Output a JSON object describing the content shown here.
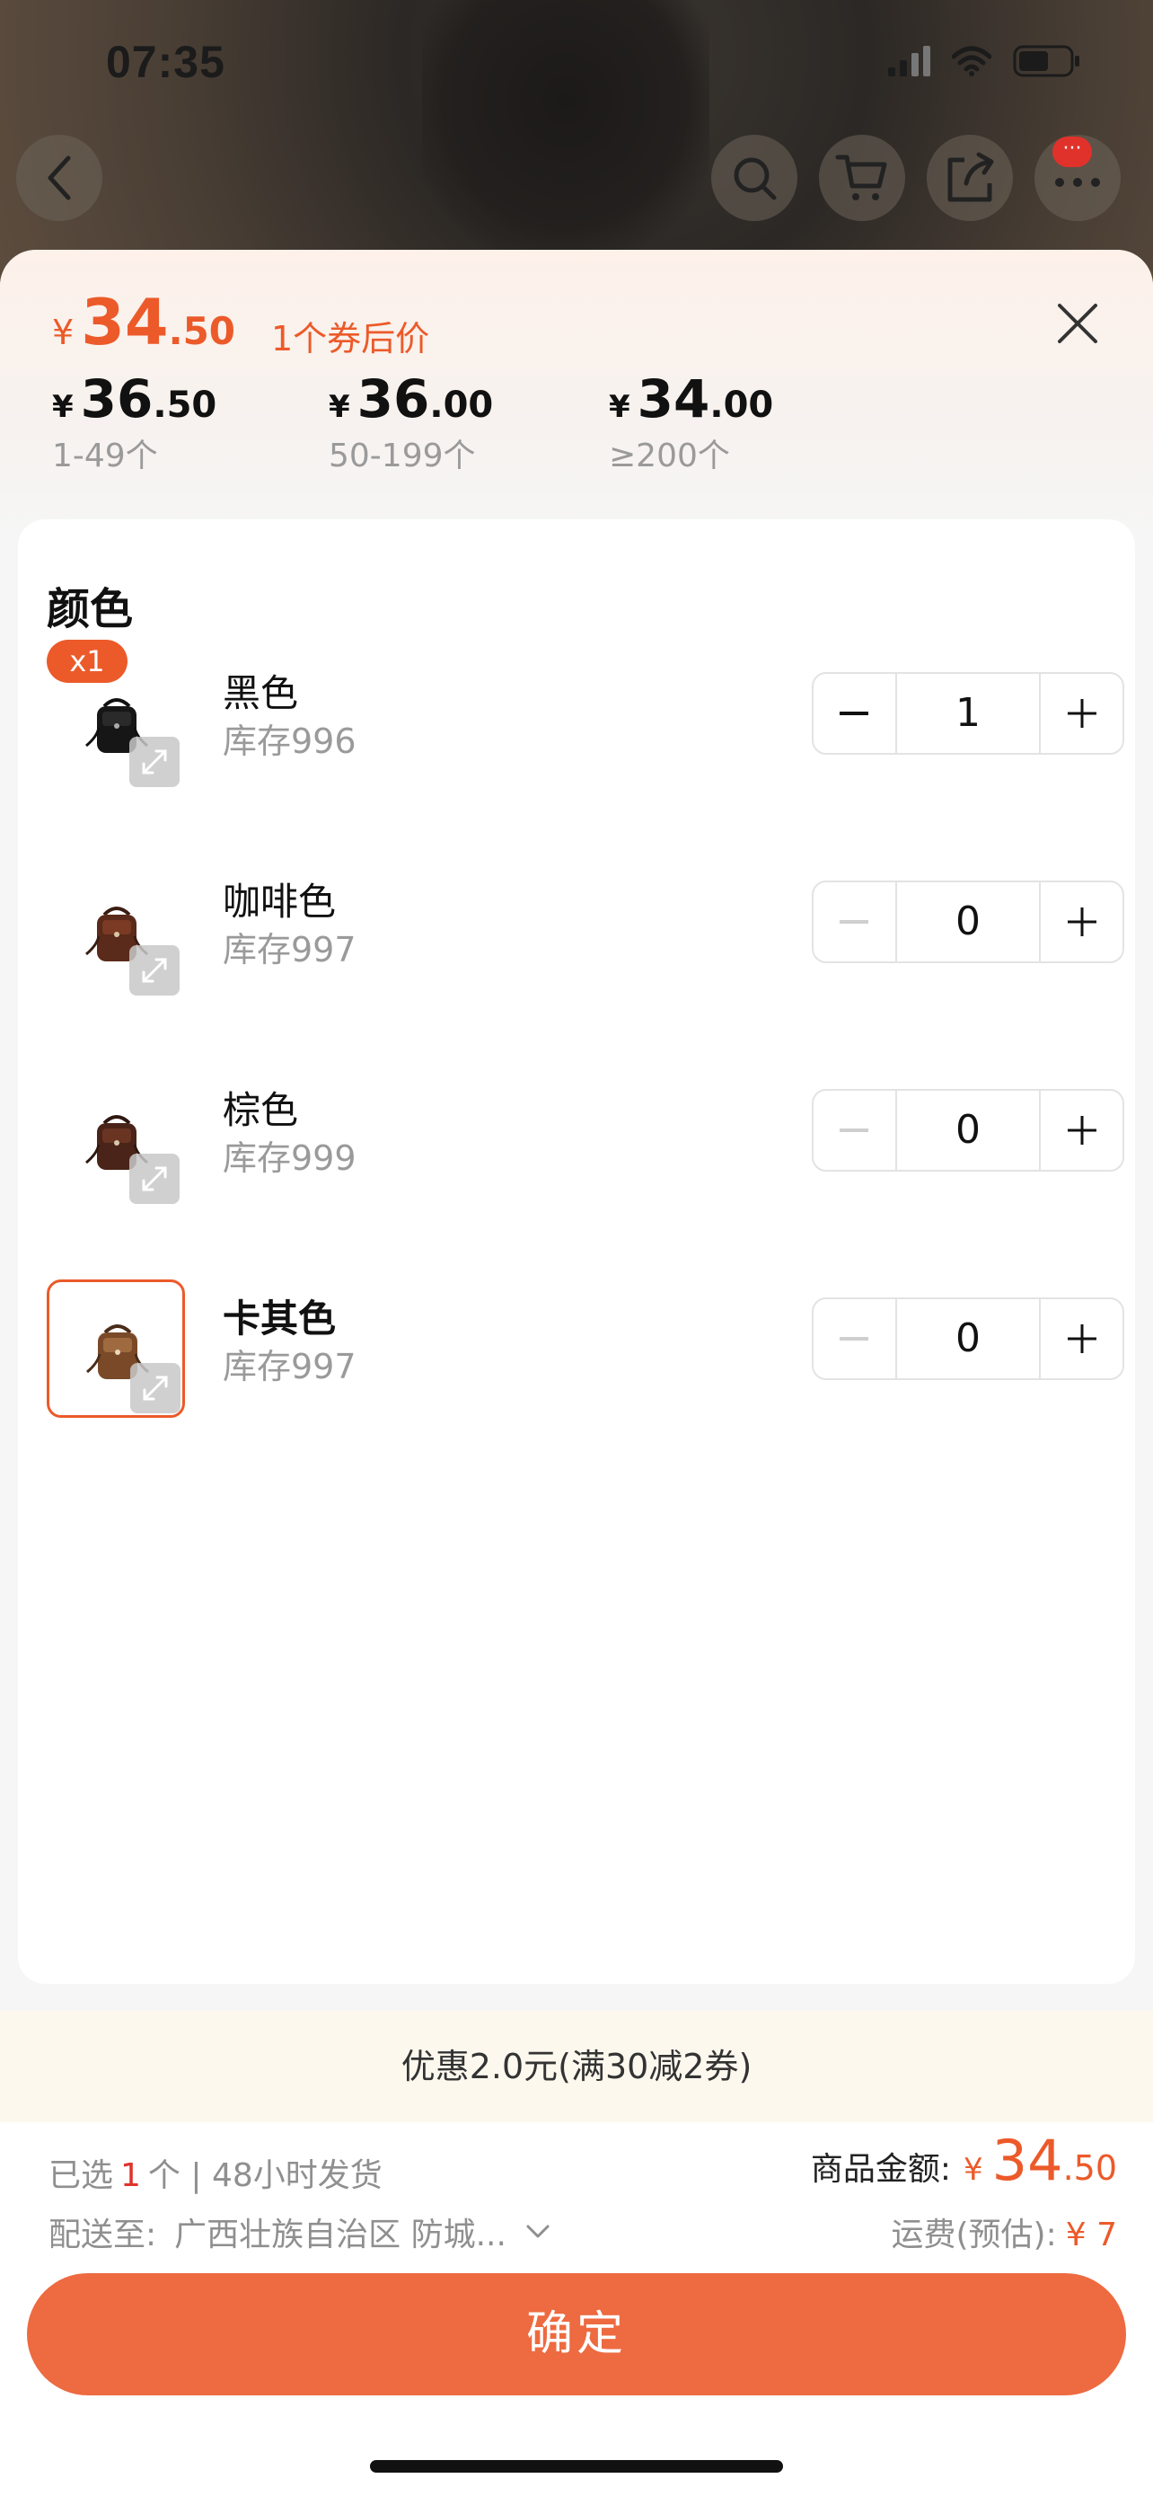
{
  "status_bar": {
    "time": "07:35"
  },
  "top_nav": {
    "badge": "···"
  },
  "price_header": {
    "currency": "¥",
    "coupon_price_int": "34",
    "coupon_price_dec": ".50",
    "coupon_label": "1个券后价",
    "tiers": [
      {
        "int": "36",
        "dec": ".50",
        "range": "1-49个"
      },
      {
        "int": "36",
        "dec": ".00",
        "range": "50-199个"
      },
      {
        "int": "34",
        "dec": ".00",
        "range": "≥200个"
      }
    ]
  },
  "color_section": {
    "title": "颜色",
    "selected_badge": "x1",
    "items": [
      {
        "name": "黑色",
        "stock": "库存996",
        "qty": "1"
      },
      {
        "name": "咖啡色",
        "stock": "库存997",
        "qty": "0"
      },
      {
        "name": "棕色",
        "stock": "库存999",
        "qty": "0"
      },
      {
        "name": "卡其色",
        "stock": "库存997",
        "qty": "0"
      }
    ]
  },
  "promo": {
    "text": "优惠2.0元(满30减2券)"
  },
  "footer": {
    "selected_prefix": "已选",
    "selected_count": "1",
    "selected_suffix": "个 | 48小时发货",
    "ship_label": "配送至:",
    "ship_address": "广西壮族自治区 防城...",
    "goods_label": "商品金额:",
    "goods_currency": "¥",
    "goods_int": "34",
    "goods_dec": ".50",
    "freight_label": "运费(预估):",
    "freight_value": "¥ 7",
    "confirm_label": "确定"
  },
  "colors": {
    "accent": "#ec5a2a",
    "button": "#ee6a40",
    "badge_red": "#e0322a",
    "promo_bg": "#fdf8ee"
  }
}
